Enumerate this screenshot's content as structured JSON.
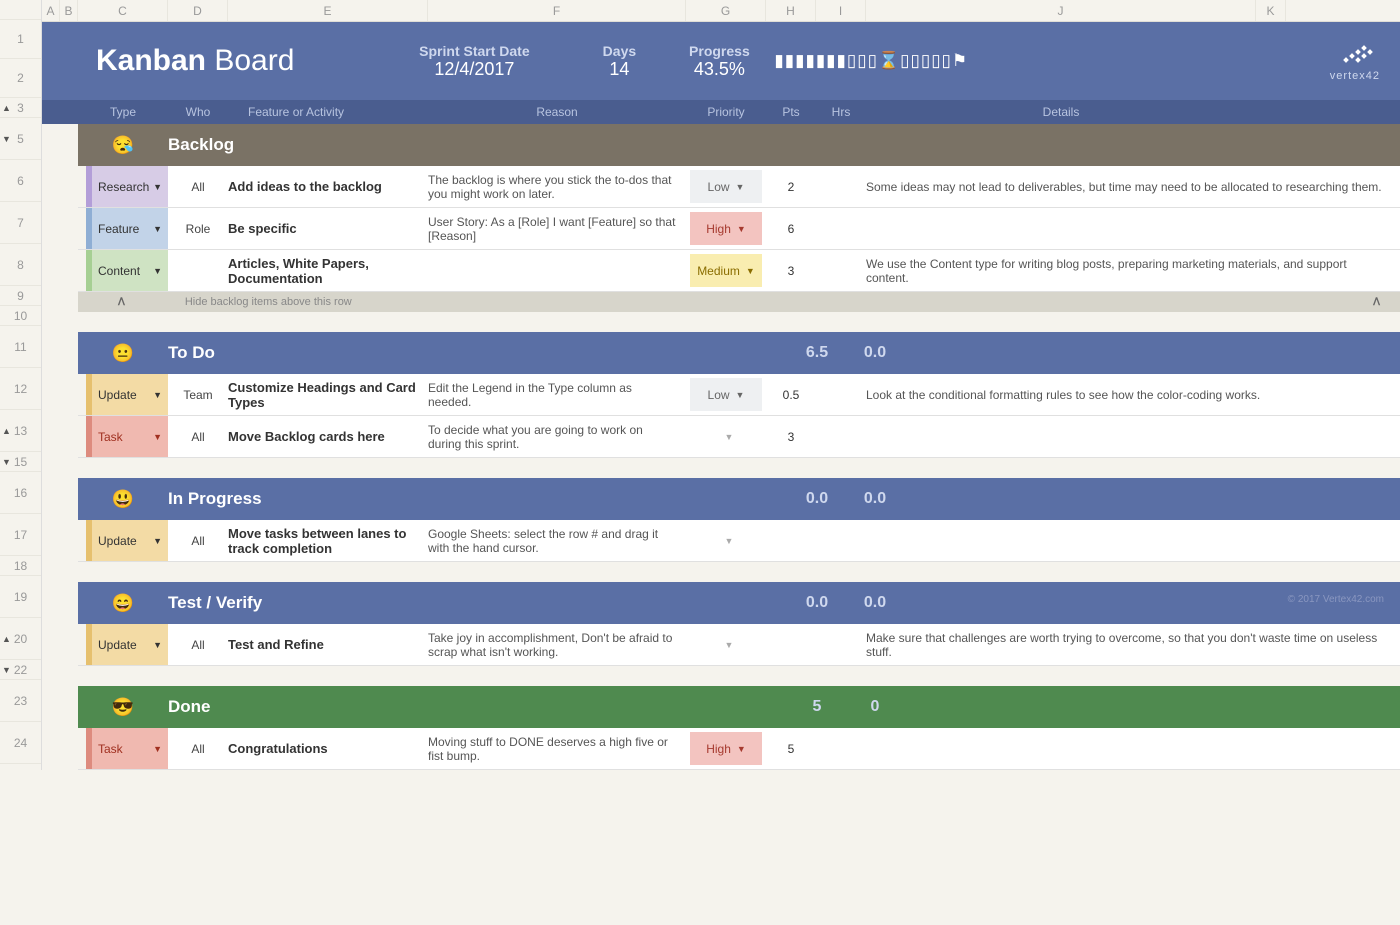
{
  "columns": [
    "A",
    "B",
    "C",
    "D",
    "E",
    "F",
    "G",
    "H",
    "I",
    "J",
    "K"
  ],
  "rownums": [
    {
      "n": "",
      "h": "colhdr"
    },
    {
      "n": "1"
    },
    {
      "n": "2"
    },
    {
      "n": "3",
      "h": "short",
      "tri": "▲"
    },
    {
      "n": "5",
      "tri": "▼"
    },
    {
      "n": "6"
    },
    {
      "n": "7"
    },
    {
      "n": "8"
    },
    {
      "n": "9",
      "h": "short"
    },
    {
      "n": "10",
      "h": "short"
    },
    {
      "n": "11"
    },
    {
      "n": "12"
    },
    {
      "n": "13",
      "tri": "▲"
    },
    {
      "n": "15",
      "h": "short",
      "tri": "▼"
    },
    {
      "n": "16"
    },
    {
      "n": "17"
    },
    {
      "n": "18",
      "h": "short"
    },
    {
      "n": "19"
    },
    {
      "n": "20",
      "tri": "▲"
    },
    {
      "n": "22",
      "h": "short",
      "tri": "▼"
    },
    {
      "n": "23"
    },
    {
      "n": "24"
    }
  ],
  "banner": {
    "title_bold": "Kanban",
    "title_rest": " Board",
    "sprint_label": "Sprint Start Date",
    "sprint_value": "12/4/2017",
    "days_label": "Days",
    "days_value": "14",
    "progress_label": "Progress",
    "progress_value": "43.5%",
    "progress_bar": "▮▮▮▮▮▮▮▯▯▯⌛▯▯▯▯▯⚑",
    "logo": "vertex42"
  },
  "headers": {
    "type": "Type",
    "who": "Who",
    "feature": "Feature or Activity",
    "reason": "Reason",
    "priority": "Priority",
    "pts": "Pts",
    "hrs": "Hrs",
    "details": "Details"
  },
  "sections": {
    "backlog": {
      "emoji": "😪",
      "title": "Backlog"
    },
    "todo": {
      "emoji": "😐",
      "title": "To Do",
      "pts": "6.5",
      "hrs": "0.0"
    },
    "inprog": {
      "emoji": "😃",
      "title": "In Progress",
      "pts": "0.0",
      "hrs": "0.0"
    },
    "test": {
      "emoji": "😄",
      "title": "Test / Verify",
      "pts": "0.0",
      "hrs": "0.0"
    },
    "done": {
      "emoji": "😎",
      "title": "Done",
      "pts": "5",
      "hrs": "0"
    }
  },
  "hidebar": {
    "caret": "ᐱ",
    "text": "Hide backlog items above this row"
  },
  "copyright": "© 2017 Vertex42.com",
  "rows": {
    "r6": {
      "type": "Research",
      "typeClass": "type-research",
      "who": "All",
      "feature": "Add ideas to the backlog",
      "reason": "The backlog is where you stick the to-dos that you might work on later.",
      "priority": "Low",
      "prioClass": "prio-low",
      "pts": "2",
      "hrs": "",
      "details": "Some ideas may not lead to deliverables, but time may need to be allocated to researching them."
    },
    "r7": {
      "type": "Feature",
      "typeClass": "type-feature",
      "who": "Role",
      "feature": "Be specific",
      "reason": "User Story: As a [Role] I want [Feature] so that [Reason]",
      "priority": "High",
      "prioClass": "prio-high",
      "pts": "6",
      "hrs": "",
      "details": ""
    },
    "r8": {
      "type": "Content",
      "typeClass": "type-content",
      "who": "",
      "feature": "Articles, White Papers, Documentation",
      "reason": "",
      "priority": "Medium",
      "prioClass": "prio-medium",
      "pts": "3",
      "hrs": "",
      "details": "We use the Content type for writing blog posts, preparing marketing materials, and support content."
    },
    "r12": {
      "type": "Update",
      "typeClass": "type-update",
      "who": "Team",
      "feature": "Customize Headings and Card Types",
      "reason": "Edit the Legend in the Type column as needed.",
      "priority": "Low",
      "prioClass": "prio-low",
      "pts": "0.5",
      "hrs": "",
      "details": "Look at the conditional formatting rules to see how the color-coding works."
    },
    "r13": {
      "type": "Task",
      "typeClass": "type-task",
      "who": "All",
      "feature": "Move Backlog cards here",
      "reason": "To decide what you are going to work on during this sprint.",
      "priority": "",
      "prioClass": "prio-none",
      "pts": "3",
      "hrs": "",
      "details": ""
    },
    "r17": {
      "type": "Update",
      "typeClass": "type-update",
      "who": "All",
      "feature": "Move tasks between lanes to track completion",
      "reason": "Google Sheets: select the row # and drag it with the hand cursor.",
      "priority": "",
      "prioClass": "prio-none",
      "pts": "",
      "hrs": "",
      "details": ""
    },
    "r20": {
      "type": "Update",
      "typeClass": "type-update",
      "who": "All",
      "feature": "Test and Refine",
      "reason": "Take joy in accomplishment, Don't be afraid to scrap what isn't working.",
      "priority": "",
      "prioClass": "prio-none",
      "pts": "",
      "hrs": "",
      "details": "Make sure that challenges are worth trying to overcome, so that you don't waste time on useless stuff."
    },
    "r24": {
      "type": "Task",
      "typeClass": "type-task",
      "who": "All",
      "feature": "Congratulations",
      "reason": "Moving stuff to DONE deserves a high five or fist bump.",
      "priority": "High",
      "prioClass": "prio-high",
      "pts": "5",
      "hrs": "",
      "details": ""
    }
  }
}
